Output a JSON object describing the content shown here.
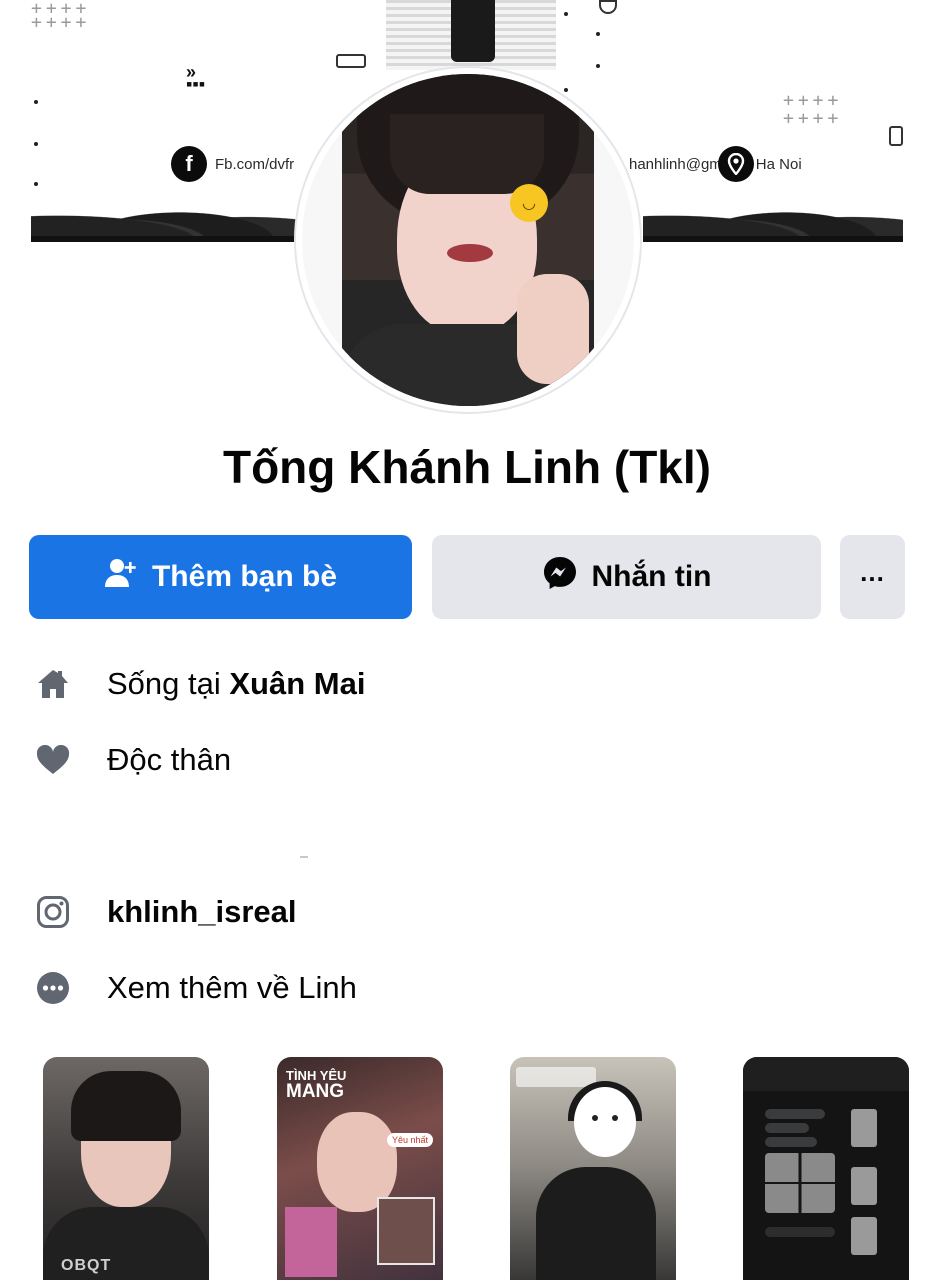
{
  "cover": {
    "fb_link": "Fb.com/dvfr",
    "email": "hanhlinh@gm",
    "location": "Ha Noi",
    "plus_marks": "++++"
  },
  "profile": {
    "name": "Tống Khánh Linh (Tkl)"
  },
  "actions": {
    "add_friend_label": "Thêm bạn bè",
    "message_label": "Nhắn tin",
    "more_label": "..."
  },
  "intro": {
    "lives_in_prefix": "Sống tại ",
    "lives_in_place": "Xuân Mai",
    "relationship": "Độc thân",
    "instagram": "khlinh_isreal",
    "see_more": "Xem thêm về Linh"
  },
  "featured": {
    "photo1_caption": "OBQT",
    "photo2_title_small": "TÌNH YÊU",
    "photo2_title_big": "MANG",
    "photo2_bubble": "Yêu nhất"
  },
  "colors": {
    "primary": "#1b74e4",
    "secondary_button": "#e4e6eb",
    "icon_gray": "#606770"
  }
}
